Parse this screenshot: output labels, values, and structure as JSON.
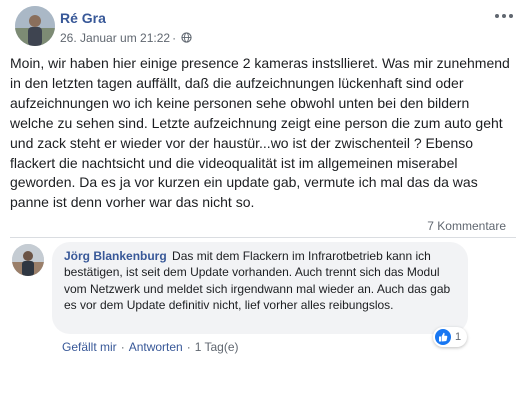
{
  "post": {
    "author": "Ré Gra",
    "date": "26. Januar um 21:22",
    "date_separator": "·",
    "text": "Moin, wir haben hier einige presence 2 kameras instsllieret. Was mir zunehmend in den letzten tagen auffällt, daß die aufzeichnungen lückenhaft sind oder aufzeichnungen wo ich keine personen sehe obwohl unten bei den bildern welche zu sehen sind. Letzte aufzeichnung zeigt eine person die zum auto geht und zack steht er wieder vor der haustür...wo ist der zwischenteil ? Ebenso flackert die nachtsicht und die videoqualität ist im allgemeinen miserabel geworden. Da es ja vor kurzen ein update gab, vermute ich mal das da was panne ist denn vorher war das nicht so.",
    "comment_count": "7 Kommentare"
  },
  "comment": {
    "author": "Jörg Blankenburg",
    "text": "Das mit dem Flackern im Infrarotbetrieb kann ich bestätigen, ist seit dem Update vorhanden. Auch trennt sich das Modul vom Netzwerk und meldet sich irgendwann mal wieder an. Auch das gab es vor dem Update definitiv nicht, lief vorher alles reibungslos.",
    "reaction_count": "1",
    "actions": {
      "like": "Gefällt mir",
      "reply": "Antworten",
      "time": "1 Tag(e)",
      "separator": "·"
    }
  },
  "icons": {
    "globe": "globe-icon",
    "more": "more-options-icon",
    "like": "like-reaction-icon"
  },
  "colors": {
    "link": "#385898",
    "text": "#1c1e21",
    "meta": "#606770",
    "bubble": "#f2f3f5",
    "like_blue": "#1877f2"
  }
}
